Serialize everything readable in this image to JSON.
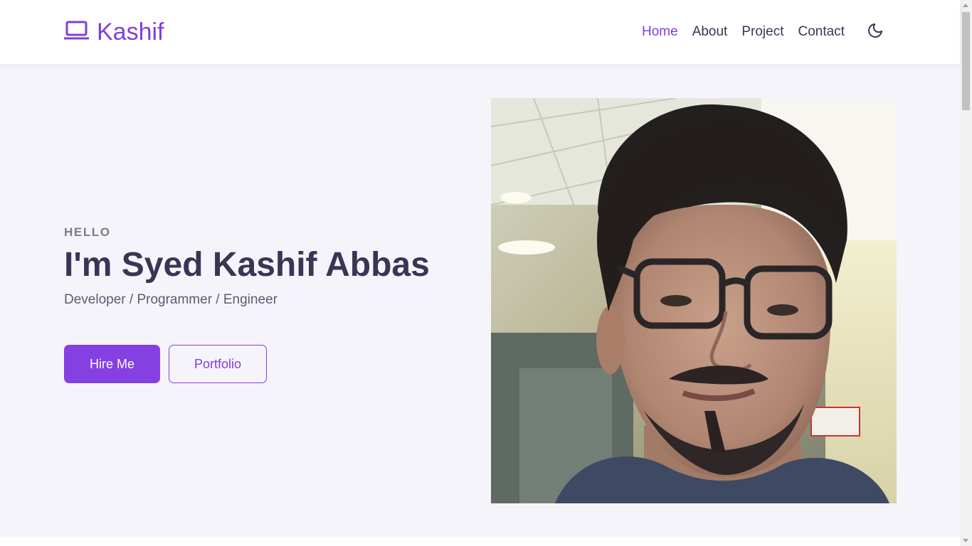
{
  "brand": {
    "name": "Kashif",
    "icon": "laptop-icon",
    "color": "#7e3fe0"
  },
  "nav": {
    "items": [
      {
        "label": "Home",
        "active": true
      },
      {
        "label": "About",
        "active": false
      },
      {
        "label": "Project",
        "active": false
      },
      {
        "label": "Contact",
        "active": false
      }
    ],
    "theme_toggle_icon": "moon-icon"
  },
  "hero": {
    "greeting": "HELLO",
    "intro": "I'm",
    "name": "Syed Kashif Abbas",
    "subtitle": "Developer / Programmer / Engineer",
    "buttons": {
      "primary": "Hire Me",
      "secondary": "Portfolio"
    },
    "photo_alt": "profile-photo"
  },
  "colors": {
    "accent": "#8540e2",
    "text_dark": "#3a3555",
    "hero_bg": "#f6f4fb"
  }
}
